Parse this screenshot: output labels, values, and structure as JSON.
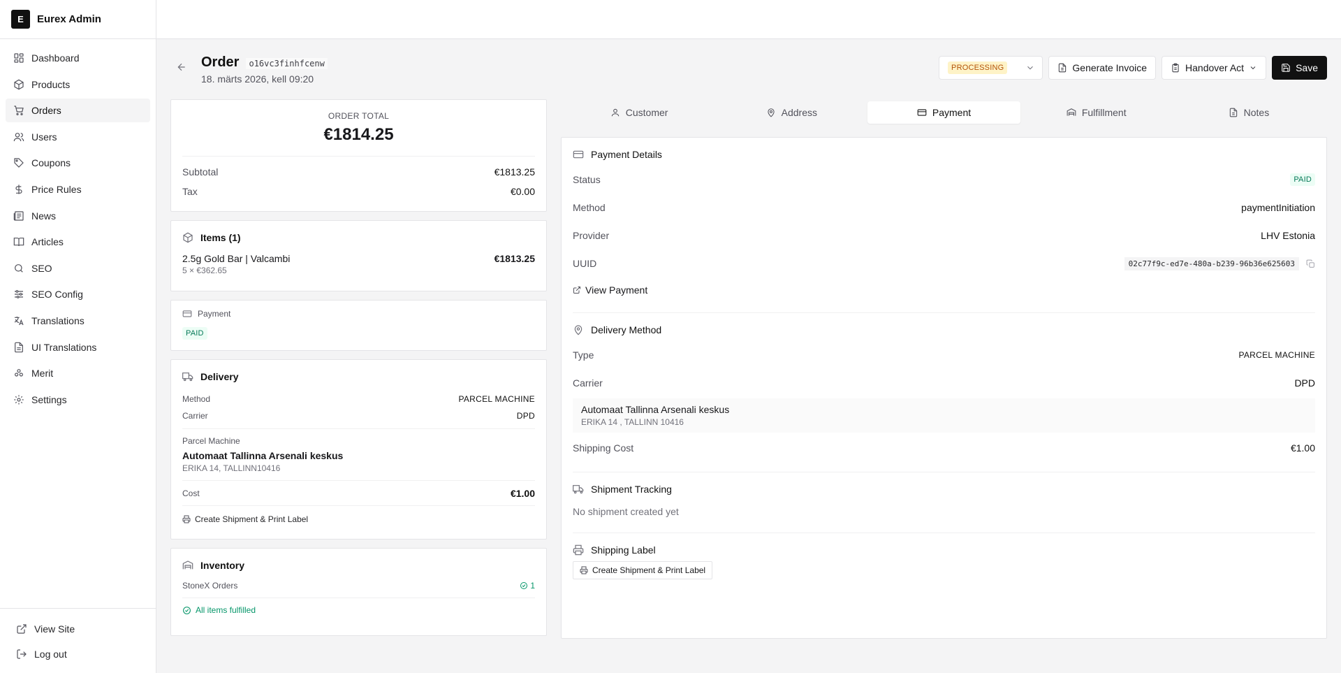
{
  "brand": {
    "logo_letter": "E",
    "name": "Eurex Admin"
  },
  "nav": {
    "items": [
      {
        "label": "Dashboard",
        "icon": "dashboard-icon"
      },
      {
        "label": "Products",
        "icon": "package-icon"
      },
      {
        "label": "Orders",
        "icon": "cart-icon"
      },
      {
        "label": "Users",
        "icon": "users-icon"
      },
      {
        "label": "Coupons",
        "icon": "tag-icon"
      },
      {
        "label": "Price Rules",
        "icon": "dollar-icon"
      },
      {
        "label": "News",
        "icon": "newspaper-icon"
      },
      {
        "label": "Articles",
        "icon": "book-icon"
      },
      {
        "label": "SEO",
        "icon": "search-icon"
      },
      {
        "label": "SEO Config",
        "icon": "sliders-icon"
      },
      {
        "label": "Translations",
        "icon": "translate-icon"
      },
      {
        "label": "UI Translations",
        "icon": "file-text-icon"
      },
      {
        "label": "Merit",
        "icon": "merit-icon"
      },
      {
        "label": "Settings",
        "icon": "gear-icon"
      }
    ],
    "active": "Orders",
    "footer": {
      "view_site": "View Site",
      "logout": "Log out"
    }
  },
  "header": {
    "title": "Order",
    "order_id": "o16vc3finhfcenw",
    "date": "18. märts 2026, kell 09:20",
    "status": "PROCESSING",
    "generate_invoice": "Generate Invoice",
    "handover_act": "Handover Act",
    "save": "Save"
  },
  "summary": {
    "label": "ORDER TOTAL",
    "total": "€1814.25",
    "subtotal_label": "Subtotal",
    "subtotal": "€1813.25",
    "tax_label": "Tax",
    "tax": "€0.00"
  },
  "items": {
    "title": "Items (1)",
    "list": [
      {
        "name": "2.5g Gold Bar | Valcambi",
        "qty_price": "5 × €362.65",
        "total": "€1813.25"
      }
    ]
  },
  "payment_card": {
    "title": "Payment",
    "status": "PAID"
  },
  "delivery": {
    "title": "Delivery",
    "method_label": "Method",
    "method": "PARCEL MACHINE",
    "carrier_label": "Carrier",
    "carrier": "DPD",
    "parcel_label": "Parcel Machine",
    "parcel_name": "Automaat Tallinna Arsenali keskus",
    "parcel_address": "ERIKA 14, TALLINN10416",
    "cost_label": "Cost",
    "cost": "€1.00",
    "create_label": "Create Shipment & Print Label"
  },
  "inventory": {
    "title": "Inventory",
    "source": "StoneX Orders",
    "count": "1",
    "fulfilled": "All items fulfilled"
  },
  "tabs": [
    {
      "label": "Customer",
      "icon": "user-icon"
    },
    {
      "label": "Address",
      "icon": "map-pin-icon"
    },
    {
      "label": "Payment",
      "icon": "credit-card-icon"
    },
    {
      "label": "Fulfillment",
      "icon": "warehouse-icon"
    },
    {
      "label": "Notes",
      "icon": "file-icon"
    }
  ],
  "active_tab": "Payment",
  "payment_details": {
    "title": "Payment Details",
    "status_label": "Status",
    "status": "PAID",
    "method_label": "Method",
    "method": "paymentInitiation",
    "provider_label": "Provider",
    "provider": "LHV Estonia",
    "uuid_label": "UUID",
    "uuid": "02c77f9c-ed7e-480a-b239-96b36e625603",
    "view_payment": "View Payment"
  },
  "delivery_method": {
    "title": "Delivery Method",
    "type_label": "Type",
    "type": "PARCEL MACHINE",
    "carrier_label": "Carrier",
    "carrier": "DPD",
    "parcel_name": "Automaat Tallinna Arsenali keskus",
    "parcel_address": "ERIKA 14 , TALLINN 10416",
    "shipping_label": "Shipping Cost",
    "shipping_cost": "€1.00"
  },
  "tracking": {
    "title": "Shipment Tracking",
    "empty": "No shipment created yet"
  },
  "shipping_label": {
    "title": "Shipping Label",
    "button": "Create Shipment & Print Label"
  },
  "colors": {
    "accent": "#111111",
    "processing_bg": "#fef3c7",
    "processing_fg": "#b45309",
    "paid_bg": "#ecfdf5",
    "paid_fg": "#047857"
  }
}
